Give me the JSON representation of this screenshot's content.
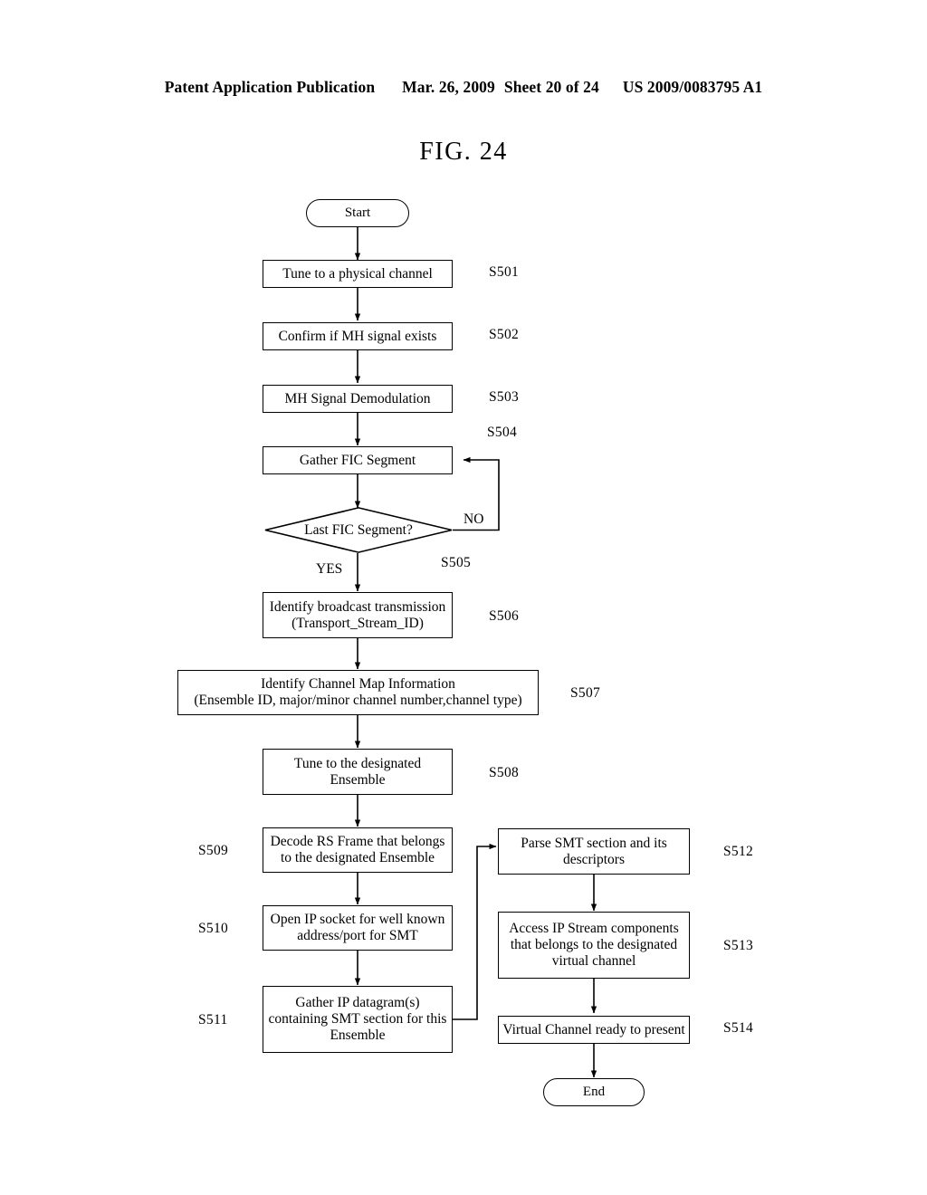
{
  "header": {
    "publication": "Patent Application Publication",
    "date": "Mar. 26, 2009",
    "sheet": "Sheet 20 of 24",
    "patent_number": "US 2009/0083795 A1"
  },
  "figure": {
    "title": "FIG. 24"
  },
  "flowchart": {
    "start_label": "Start",
    "end_label": "End",
    "branch_yes": "YES",
    "branch_no": "NO",
    "steps": [
      {
        "id": "S501",
        "text": "Tune to a physical channel"
      },
      {
        "id": "S502",
        "text": "Confirm if MH signal exists"
      },
      {
        "id": "S503",
        "text": "MH Signal Demodulation"
      },
      {
        "id": "S504",
        "text": "Gather FIC Segment"
      },
      {
        "id": "S505",
        "text": "Last FIC Segment?"
      },
      {
        "id": "S506",
        "line1": "Identify broadcast transmission",
        "line2": "(Transport_Stream_ID)"
      },
      {
        "id": "S507",
        "line1": "Identify Channel Map Information",
        "line2": "(Ensemble ID, major/minor channel number,channel type)"
      },
      {
        "id": "S508",
        "line1": "Tune to the designated",
        "line2": "Ensemble"
      },
      {
        "id": "S509",
        "line1": "Decode RS Frame that belongs",
        "line2": "to the designated Ensemble"
      },
      {
        "id": "S510",
        "line1": "Open IP socket for well known",
        "line2": "address/port for SMT"
      },
      {
        "id": "S511",
        "line1": "Gather IP datagram(s)",
        "line2": "containing SMT section for this",
        "line3": "Ensemble"
      },
      {
        "id": "S512",
        "line1": "Parse SMT section and its",
        "line2": "descriptors"
      },
      {
        "id": "S513",
        "line1": "Access IP Stream components",
        "line2": "that belongs to the designated",
        "line3": "virtual channel"
      },
      {
        "id": "S514",
        "text": "Virtual Channel ready to present"
      }
    ]
  }
}
